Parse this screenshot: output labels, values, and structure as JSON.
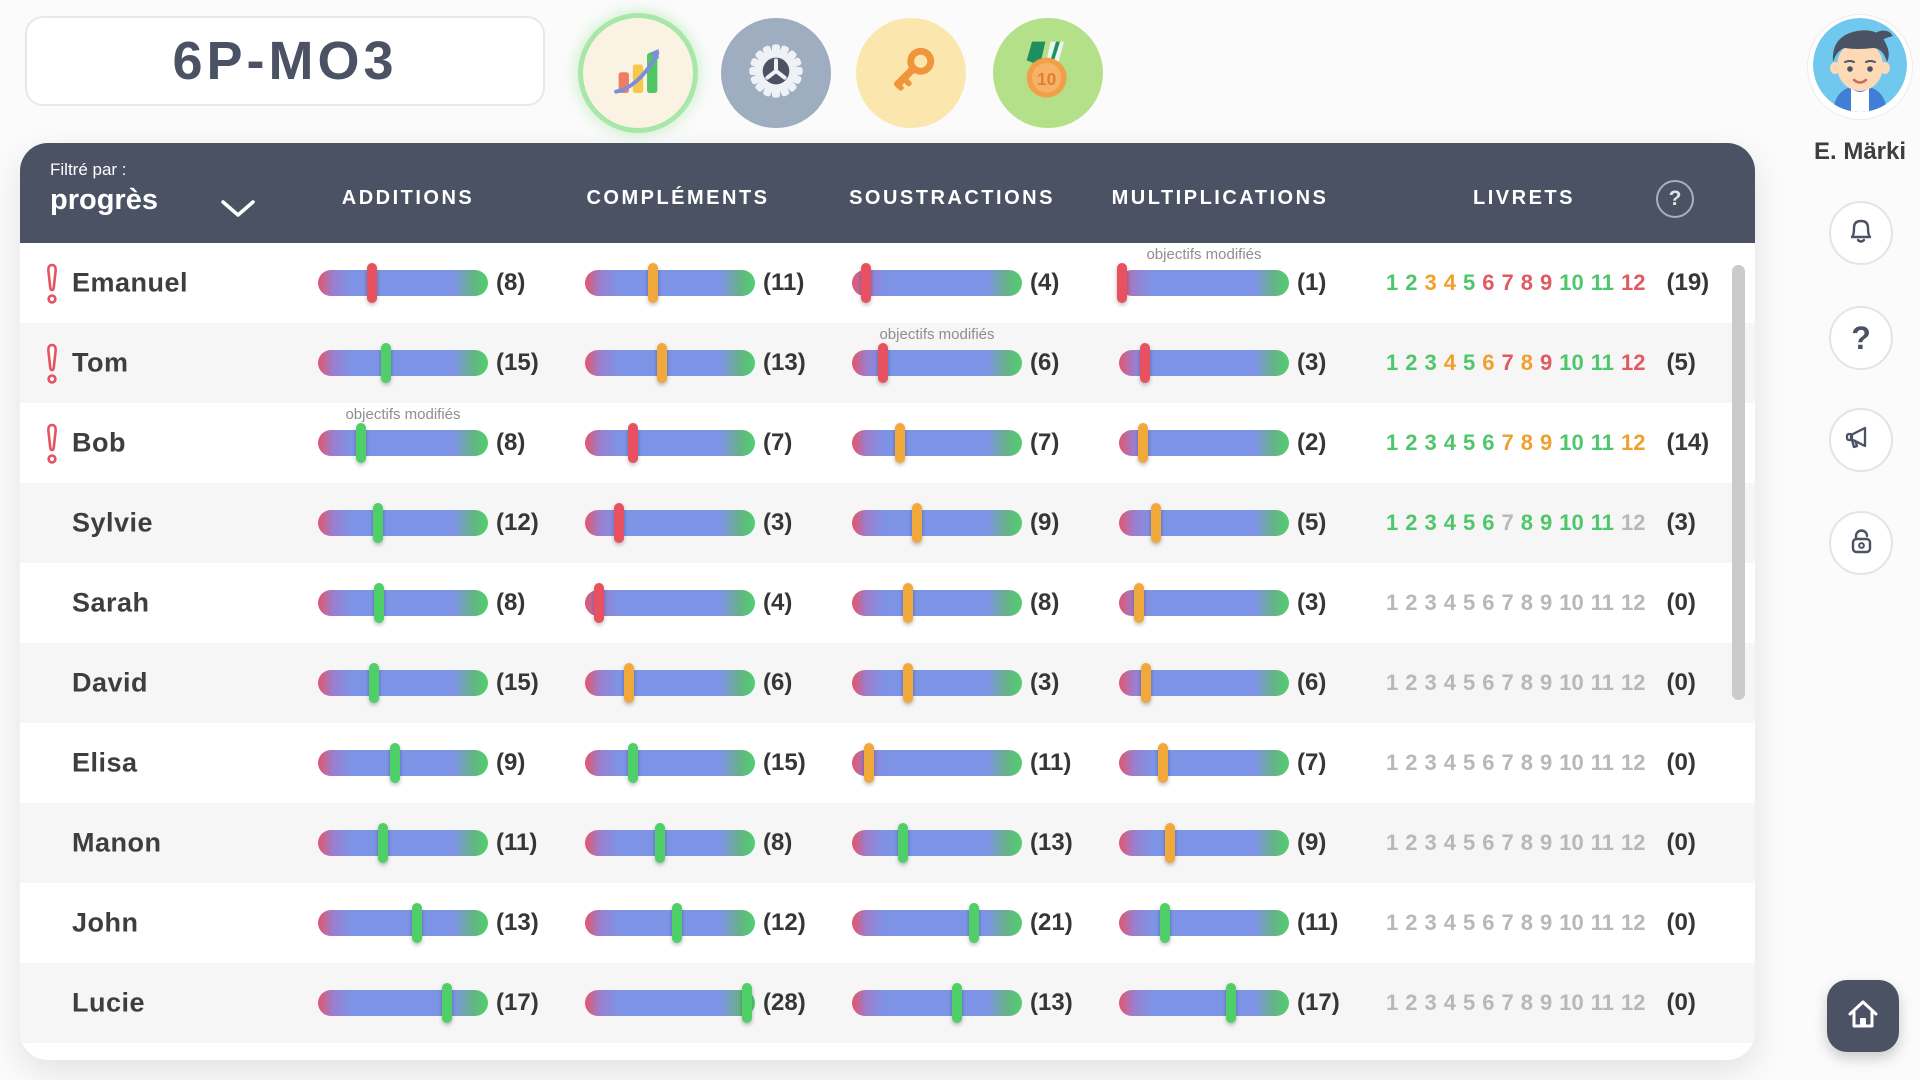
{
  "app": {
    "class_name": "6P-MO3"
  },
  "toolbar": {
    "icons": [
      {
        "name": "progress-chart",
        "active": true
      },
      {
        "name": "settings",
        "active": false
      },
      {
        "name": "access-key",
        "active": false
      },
      {
        "name": "rewards-medal",
        "active": false,
        "badge": "10"
      }
    ]
  },
  "profile": {
    "name": "E. Märki"
  },
  "rail": {
    "buttons": [
      "notifications",
      "help",
      "announcements",
      "lock"
    ]
  },
  "table": {
    "filter_label": "Filtré par :",
    "filter_value": "progrès",
    "columns": [
      "ADDITIONS",
      "COMPLÉMENTS",
      "SOUSTRACTIONS",
      "MULTIPLICATIONS",
      "LIVRETS"
    ],
    "modified_label": "objectifs modifiés",
    "rows": [
      {
        "name": "Emanuel",
        "alert": true,
        "skills": [
          {
            "column": "additions",
            "marker": "red",
            "position": 32,
            "count": 8,
            "modified": false
          },
          {
            "column": "complements",
            "marker": "orange",
            "position": 40,
            "count": 11,
            "modified": false
          },
          {
            "column": "soustractions",
            "marker": "red",
            "position": 8,
            "count": 4,
            "modified": false
          },
          {
            "column": "multiplications",
            "marker": "red",
            "position": 2,
            "count": 1,
            "modified": true
          }
        ],
        "livrets": {
          "colors": [
            "green",
            "green",
            "orange",
            "orange",
            "green",
            "red",
            "red",
            "red",
            "red",
            "green",
            "green",
            "red"
          ],
          "total": 19
        }
      },
      {
        "name": "Tom",
        "alert": true,
        "skills": [
          {
            "column": "additions",
            "marker": "green",
            "position": 40,
            "count": 15,
            "modified": false
          },
          {
            "column": "complements",
            "marker": "orange",
            "position": 45,
            "count": 13,
            "modified": false
          },
          {
            "column": "soustractions",
            "marker": "red",
            "position": 18,
            "count": 6,
            "modified": true
          },
          {
            "column": "multiplications",
            "marker": "red",
            "position": 15,
            "count": 3,
            "modified": false
          }
        ],
        "livrets": {
          "colors": [
            "green",
            "green",
            "green",
            "orange",
            "green",
            "orange",
            "red",
            "orange",
            "red",
            "green",
            "green",
            "red"
          ],
          "total": 5
        }
      },
      {
        "name": "Bob",
        "alert": true,
        "skills": [
          {
            "column": "additions",
            "marker": "green",
            "position": 25,
            "count": 8,
            "modified": true
          },
          {
            "column": "complements",
            "marker": "red",
            "position": 28,
            "count": 7,
            "modified": false
          },
          {
            "column": "soustractions",
            "marker": "orange",
            "position": 28,
            "count": 7,
            "modified": false
          },
          {
            "column": "multiplications",
            "marker": "orange",
            "position": 14,
            "count": 2,
            "modified": false
          }
        ],
        "livrets": {
          "colors": [
            "green",
            "green",
            "green",
            "green",
            "green",
            "green",
            "orange",
            "orange",
            "orange",
            "green",
            "green",
            "orange"
          ],
          "total": 14
        }
      },
      {
        "name": "Sylvie",
        "alert": false,
        "skills": [
          {
            "column": "additions",
            "marker": "green",
            "position": 35,
            "count": 12,
            "modified": false
          },
          {
            "column": "complements",
            "marker": "red",
            "position": 20,
            "count": 3,
            "modified": false
          },
          {
            "column": "soustractions",
            "marker": "orange",
            "position": 38,
            "count": 9,
            "modified": false
          },
          {
            "column": "multiplications",
            "marker": "orange",
            "position": 22,
            "count": 5,
            "modified": false
          }
        ],
        "livrets": {
          "colors": [
            "green",
            "green",
            "green",
            "green",
            "green",
            "green",
            "gray",
            "green",
            "green",
            "green",
            "green",
            "gray"
          ],
          "total": 3
        }
      },
      {
        "name": "Sarah",
        "alert": false,
        "skills": [
          {
            "column": "additions",
            "marker": "green",
            "position": 36,
            "count": 8,
            "modified": false
          },
          {
            "column": "complements",
            "marker": "red",
            "position": 8,
            "count": 4,
            "modified": false
          },
          {
            "column": "soustractions",
            "marker": "orange",
            "position": 33,
            "count": 8,
            "modified": false
          },
          {
            "column": "multiplications",
            "marker": "orange",
            "position": 12,
            "count": 3,
            "modified": false
          }
        ],
        "livrets": {
          "colors": [
            "gray",
            "gray",
            "gray",
            "gray",
            "gray",
            "gray",
            "gray",
            "gray",
            "gray",
            "gray",
            "gray",
            "gray"
          ],
          "total": 0
        }
      },
      {
        "name": "David",
        "alert": false,
        "skills": [
          {
            "column": "additions",
            "marker": "green",
            "position": 33,
            "count": 15,
            "modified": false
          },
          {
            "column": "complements",
            "marker": "orange",
            "position": 26,
            "count": 6,
            "modified": false
          },
          {
            "column": "soustractions",
            "marker": "orange",
            "position": 33,
            "count": 3,
            "modified": false
          },
          {
            "column": "multiplications",
            "marker": "orange",
            "position": 16,
            "count": 6,
            "modified": false
          }
        ],
        "livrets": {
          "colors": [
            "gray",
            "gray",
            "gray",
            "gray",
            "gray",
            "gray",
            "gray",
            "gray",
            "gray",
            "gray",
            "gray",
            "gray"
          ],
          "total": 0
        }
      },
      {
        "name": "Elisa",
        "alert": false,
        "skills": [
          {
            "column": "additions",
            "marker": "green",
            "position": 45,
            "count": 9,
            "modified": false
          },
          {
            "column": "complements",
            "marker": "green",
            "position": 28,
            "count": 15,
            "modified": false
          },
          {
            "column": "soustractions",
            "marker": "orange",
            "position": 10,
            "count": 11,
            "modified": false
          },
          {
            "column": "multiplications",
            "marker": "orange",
            "position": 26,
            "count": 7,
            "modified": false
          }
        ],
        "livrets": {
          "colors": [
            "gray",
            "gray",
            "gray",
            "gray",
            "gray",
            "gray",
            "gray",
            "gray",
            "gray",
            "gray",
            "gray",
            "gray"
          ],
          "total": 0
        }
      },
      {
        "name": "Manon",
        "alert": false,
        "skills": [
          {
            "column": "additions",
            "marker": "green",
            "position": 38,
            "count": 11,
            "modified": false
          },
          {
            "column": "complements",
            "marker": "green",
            "position": 44,
            "count": 8,
            "modified": false
          },
          {
            "column": "soustractions",
            "marker": "green",
            "position": 30,
            "count": 13,
            "modified": false
          },
          {
            "column": "multiplications",
            "marker": "orange",
            "position": 30,
            "count": 9,
            "modified": false
          }
        ],
        "livrets": {
          "colors": [
            "gray",
            "gray",
            "gray",
            "gray",
            "gray",
            "gray",
            "gray",
            "gray",
            "gray",
            "gray",
            "gray",
            "gray"
          ],
          "total": 0
        }
      },
      {
        "name": "John",
        "alert": false,
        "skills": [
          {
            "column": "additions",
            "marker": "green",
            "position": 58,
            "count": 13,
            "modified": false
          },
          {
            "column": "complements",
            "marker": "green",
            "position": 54,
            "count": 12,
            "modified": false
          },
          {
            "column": "soustractions",
            "marker": "green",
            "position": 72,
            "count": 21,
            "modified": false
          },
          {
            "column": "multiplications",
            "marker": "green",
            "position": 27,
            "count": 11,
            "modified": false
          }
        ],
        "livrets": {
          "colors": [
            "gray",
            "gray",
            "gray",
            "gray",
            "gray",
            "gray",
            "gray",
            "gray",
            "gray",
            "gray",
            "gray",
            "gray"
          ],
          "total": 0
        }
      },
      {
        "name": "Lucie",
        "alert": false,
        "skills": [
          {
            "column": "additions",
            "marker": "green",
            "position": 76,
            "count": 17,
            "modified": false
          },
          {
            "column": "complements",
            "marker": "green",
            "position": 95,
            "count": 28,
            "modified": false
          },
          {
            "column": "soustractions",
            "marker": "green",
            "position": 62,
            "count": 13,
            "modified": false
          },
          {
            "column": "multiplications",
            "marker": "green",
            "position": 66,
            "count": 17,
            "modified": false
          }
        ],
        "livrets": {
          "colors": [
            "gray",
            "gray",
            "gray",
            "gray",
            "gray",
            "gray",
            "gray",
            "gray",
            "gray",
            "gray",
            "gray",
            "gray"
          ],
          "total": 0
        }
      }
    ]
  },
  "colors": {
    "slate": "#4a5263",
    "marker_red": "#e8515f",
    "marker_orange": "#f2a93c",
    "marker_green": "#4ecf67",
    "livret_green": "#4fc768",
    "livret_orange": "#efa02f",
    "livret_red": "#e25a61",
    "livret_gray": "#b8b8b8"
  }
}
